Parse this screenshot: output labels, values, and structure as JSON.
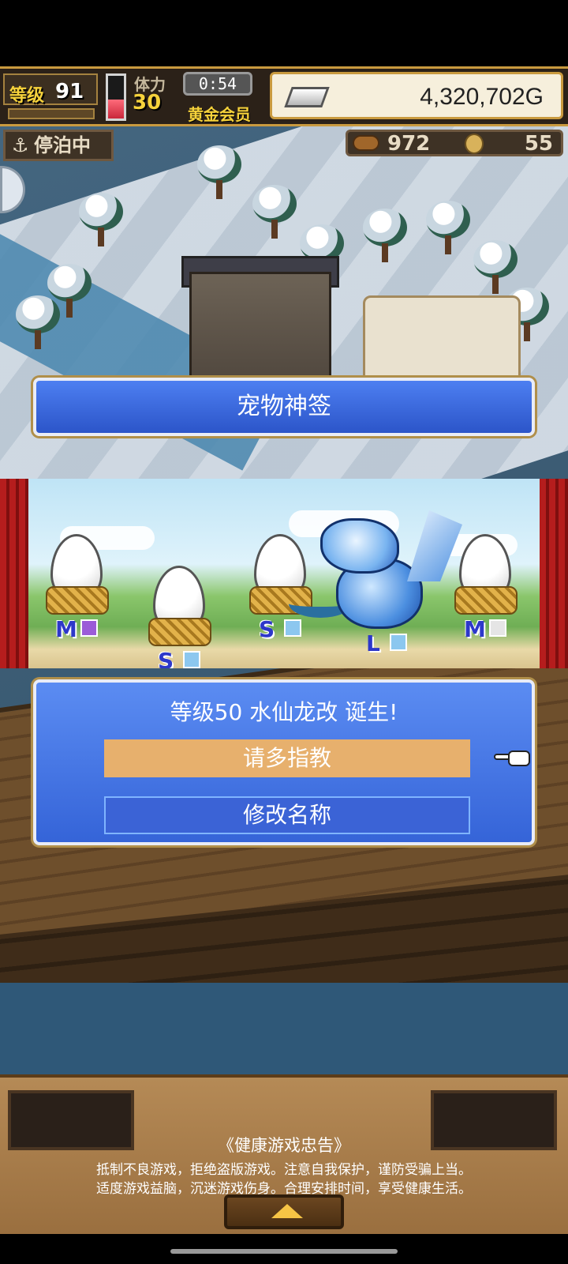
{
  "hud": {
    "level_label": "等级",
    "level": "91",
    "stamina_label": "体力",
    "stamina": "30",
    "timer": "0:54",
    "membership": "黄金会员",
    "gold": "4,320,702G",
    "status": "停泊中",
    "wood": "972",
    "coins": "55"
  },
  "dialog": {
    "title": "宠物神签",
    "result": "等级50 水仙龙改 诞生!",
    "confirm_label": "请多指教",
    "rename_label": "修改名称"
  },
  "eggs": [
    {
      "size": "M",
      "gem": "purple"
    },
    {
      "size": "S",
      "gem": "ice"
    },
    {
      "size": "S",
      "gem": "ice"
    },
    {
      "size": "M",
      "gem": "white"
    }
  ],
  "dragon": {
    "size": "L",
    "gem": "ice"
  },
  "notice": {
    "title": "《健康游戏忠告》",
    "line1": "抵制不良游戏，拒绝盗版游戏。注意自我保护，谨防受骗上当。",
    "line2": "适度游戏益脑，沉迷游戏伤身。合理安排时间，享受健康生活。"
  }
}
